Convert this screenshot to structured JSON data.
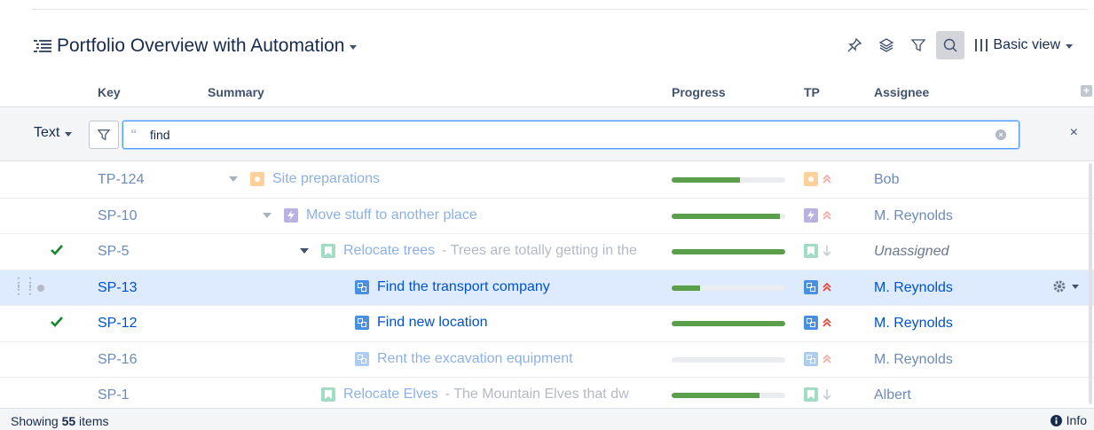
{
  "header": {
    "title": "Portfolio Overview with Automation",
    "view_label": "Basic view",
    "toolbar_icons": [
      "pin-icon",
      "layers-icon",
      "filter-icon",
      "search-icon",
      "columns-icon"
    ]
  },
  "columns": {
    "key": "Key",
    "summary": "Summary",
    "progress": "Progress",
    "tp": "TP",
    "assignee": "Assignee"
  },
  "filter": {
    "type_label": "Text",
    "query": "find",
    "close": "×"
  },
  "rows": [
    {
      "key": "TP-124",
      "summary": "Site preparations",
      "description": "",
      "progress": 0.6,
      "priority": "highest",
      "assignee": "Bob",
      "type": "epic",
      "checked": false,
      "faded": true,
      "expandable": true,
      "indent": 1
    },
    {
      "key": "SP-10",
      "summary": "Move stuff to another place",
      "description": "",
      "progress": 0.95,
      "priority": "highest",
      "assignee": "M. Reynolds",
      "type": "feature",
      "checked": false,
      "faded": true,
      "expandable": true,
      "indent": 2
    },
    {
      "key": "SP-5",
      "summary": "Relocate trees",
      "description": "-  Trees are totally getting in the",
      "progress": 1.0,
      "priority": "low",
      "assignee": "Unassigned",
      "type": "story",
      "checked": true,
      "faded": true,
      "expandable": true,
      "indent": 3
    },
    {
      "key": "SP-13",
      "summary": "Find the transport company",
      "description": "",
      "progress": 0.25,
      "priority": "highest",
      "assignee": "M. Reynolds",
      "type": "subtask",
      "checked": false,
      "faded": false,
      "expandable": false,
      "indent": 4,
      "selected": true
    },
    {
      "key": "SP-12",
      "summary": "Find new location",
      "description": "",
      "progress": 1.0,
      "priority": "highest",
      "assignee": "M. Reynolds",
      "type": "subtask",
      "checked": true,
      "faded": false,
      "expandable": false,
      "indent": 4
    },
    {
      "key": "SP-16",
      "summary": "Rent the excavation equipment",
      "description": "",
      "progress": 0.0,
      "priority": "highest",
      "assignee": "M. Reynolds",
      "type": "subtask",
      "checked": false,
      "faded": true,
      "expandable": false,
      "indent": 4
    },
    {
      "key": "SP-1",
      "summary": "Relocate Elves",
      "description": "-  The Mountain Elves that dw",
      "progress": 0.77,
      "priority": "low",
      "assignee": "Albert",
      "type": "story",
      "checked": false,
      "faded": true,
      "expandable": false,
      "indent": 3
    }
  ],
  "footer": {
    "showing_prefix": "Showing ",
    "count": "55",
    "showing_suffix": " items",
    "info_label": "Info"
  },
  "colors": {
    "progress_fill": "#5b9f4d",
    "link_blue": "#0052cc",
    "selected_bg": "#deebff",
    "check_green": "#14892c",
    "priority_red": "#e5493a"
  }
}
